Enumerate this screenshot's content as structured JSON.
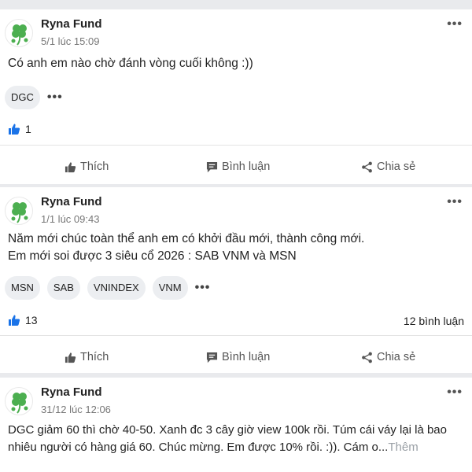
{
  "posts": [
    {
      "author": "Ryna Fund",
      "time": "5/1 lúc 15:09",
      "content_lines": [
        "Có anh em nào chờ đánh vòng cuối không :))"
      ],
      "tags": [
        "DGC"
      ],
      "likes": "1",
      "comments": ""
    },
    {
      "author": "Ryna Fund",
      "time": "1/1 lúc 09:43",
      "content_lines": [
        "Năm mới chúc toàn thể anh em có khởi đầu mới, thành công mới.",
        "Em mới soi được 3 siêu cổ 2026 : SAB VNM và MSN"
      ],
      "tags": [
        "MSN",
        "SAB",
        "VNINDEX",
        "VNM"
      ],
      "likes": "13",
      "comments": "12 bình luận"
    },
    {
      "author": "Ryna Fund",
      "time": "31/12 lúc 12:06",
      "content_lines": [
        "DGC  giảm 60 thì chờ 40-50. Xanh đc 3 cây giờ view 100k rồi. Túm cái váy lại là bao",
        "nhiêu người có hàng giá 60. Chúc mừng. Em được 10% rồi. :)). Cám o..."
      ],
      "see_more": "Thêm"
    }
  ],
  "actions": {
    "like": "Thích",
    "comment": "Bình luận",
    "share": "Chia sẻ"
  },
  "icons": {
    "avatar": "clover-icon",
    "more": "more-dots-icon",
    "like": "thumbs-up-icon",
    "comment": "comment-icon",
    "share": "share-icon"
  },
  "colors": {
    "like_blue": "#1a73e8",
    "clover_green": "#4caf50",
    "text": "#222222",
    "muted": "#777777",
    "see_more": "#9aa0a6"
  }
}
